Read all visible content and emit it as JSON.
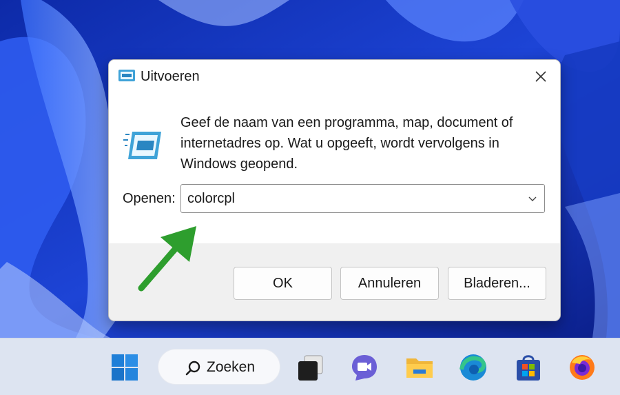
{
  "dialog": {
    "title": "Uitvoeren",
    "description": "Geef de naam van een programma, map, document of internetadres op. Wat u opgeeft, wordt vervolgens in Windows geopend.",
    "open_label": "Openen:",
    "open_value": "colorcpl",
    "buttons": {
      "ok": "OK",
      "cancel": "Annuleren",
      "browse": "Bladeren..."
    }
  },
  "taskbar": {
    "search_label": "Zoeken",
    "items": [
      "windows-start-icon",
      "search-icon",
      "task-view-icon",
      "teams-chat-icon",
      "file-explorer-icon",
      "edge-icon",
      "microsoft-store-icon",
      "firefox-icon"
    ]
  },
  "colors": {
    "wallpaper_blue": "#1a3fd1",
    "annotation_arrow": "#2e9e2e",
    "taskbar": "#dde4f1",
    "dialog_footer": "#f0f0f0"
  }
}
